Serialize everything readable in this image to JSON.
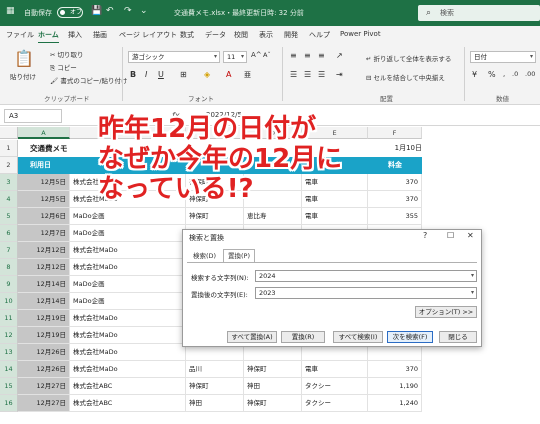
{
  "titlebar": {
    "autosave_label": "自動保存",
    "autosave_state": "オフ",
    "document_title": "交通費メモ.xlsx・最終更新日時: 32 分前",
    "search_placeholder": "検索"
  },
  "ribbon_tabs": [
    "ファイル",
    "ホーム",
    "挿入",
    "描画",
    "ページ レイアウト",
    "数式",
    "データ",
    "校閲",
    "表示",
    "開発",
    "ヘルプ",
    "Power Pivot"
  ],
  "active_tab": "ホーム",
  "ribbon": {
    "paste_label": "貼り付け",
    "cut_label": "切り取り",
    "copy_label": "コピー",
    "format_painter_label": "書式のコピー/貼り付け",
    "clipboard_group": "クリップボード",
    "font_name": "游ゴシック",
    "font_size": "11",
    "font_group": "フォント",
    "wrap_text_label": "折り返して全体を表示する",
    "merge_center_label": "セルを結合して中央揃え",
    "alignment_group": "配置",
    "number_format": "日付",
    "number_group": "数値"
  },
  "formula_bar": {
    "name_box": "A3",
    "fx_label": "fx",
    "value": "2022/12/5"
  },
  "sheet": {
    "columns": [
      "A",
      "B",
      "C",
      "D",
      "E",
      "F"
    ],
    "title": "交通費メモ",
    "f1_value": "1月10日",
    "header_date": "利用日",
    "header_fee": "料金",
    "rows": [
      {
        "row": "3",
        "date": "12月5日",
        "company": "株式会社MaDo",
        "from": "神保町",
        "to": "",
        "transport": "電車",
        "fee": "370"
      },
      {
        "row": "4",
        "date": "12月5日",
        "company": "株式会社MaDo",
        "from": "神保町",
        "to": "",
        "transport": "電車",
        "fee": "370"
      },
      {
        "row": "5",
        "date": "12月6日",
        "company": "MaDo企画",
        "from": "神保町",
        "to": "恵比寿",
        "transport": "電車",
        "fee": "355"
      },
      {
        "row": "6",
        "date": "12月7日",
        "company": "MaDo企画",
        "from": "神保町",
        "to": "恵比寿",
        "transport": "電車",
        "fee": "355"
      },
      {
        "row": "7",
        "date": "12月12日",
        "company": "株式会社MaDo",
        "from": "",
        "to": "",
        "transport": "",
        "fee": ""
      },
      {
        "row": "8",
        "date": "12月12日",
        "company": "株式会社MaDo",
        "from": "",
        "to": "",
        "transport": "",
        "fee": ""
      },
      {
        "row": "9",
        "date": "12月14日",
        "company": "MaDo企画",
        "from": "",
        "to": "",
        "transport": "",
        "fee": ""
      },
      {
        "row": "10",
        "date": "12月14日",
        "company": "MaDo企画",
        "from": "",
        "to": "",
        "transport": "",
        "fee": ""
      },
      {
        "row": "11",
        "date": "12月19日",
        "company": "株式会社MaDo",
        "from": "",
        "to": "",
        "transport": "",
        "fee": ""
      },
      {
        "row": "12",
        "date": "12月19日",
        "company": "株式会社MaDo",
        "from": "",
        "to": "",
        "transport": "",
        "fee": ""
      },
      {
        "row": "13",
        "date": "12月26日",
        "company": "株式会社MaDo",
        "from": "",
        "to": "",
        "transport": "",
        "fee": ""
      },
      {
        "row": "14",
        "date": "12月26日",
        "company": "株式会社MaDo",
        "from": "品川",
        "to": "神保町",
        "transport": "電車",
        "fee": "370"
      },
      {
        "row": "15",
        "date": "12月27日",
        "company": "株式会社ABC",
        "from": "神保町",
        "to": "神田",
        "transport": "タクシー",
        "fee": "1,190"
      },
      {
        "row": "16",
        "date": "12月27日",
        "company": "株式会社ABC",
        "from": "神田",
        "to": "神保町",
        "transport": "タクシー",
        "fee": "1,240"
      }
    ]
  },
  "dialog": {
    "title": "検索と置換",
    "tab_find": "検索(D)",
    "tab_replace": "置換(P)",
    "find_label": "検索する文字列(N):",
    "find_value": "2024",
    "replace_label": "置換後の文字列(E):",
    "replace_value": "2023",
    "options_button": "オプション(T) >>",
    "replace_all_button": "すべて置換(A)",
    "replace_button": "置換(R)",
    "find_all_button": "すべて検索(I)",
    "find_next_button": "次を検索(F)",
    "close_button": "閉じる"
  },
  "annotation": "昨年12月の日付が\nなぜか今年の12月に\nなっている!?",
  "colors": {
    "excel_green": "#1e7145",
    "header_blue": "#1aa3c8",
    "annotation_red": "#e02222"
  }
}
